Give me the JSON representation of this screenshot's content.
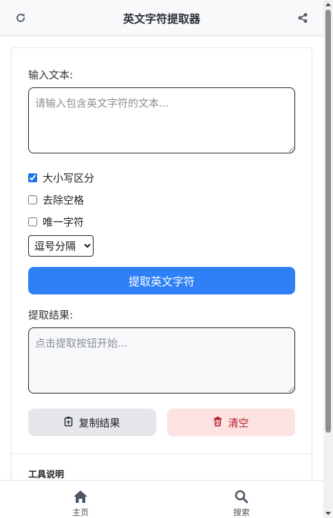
{
  "header": {
    "title": "英文字符提取器",
    "left_icon": "refresh-icon",
    "right_icon": "share-icon"
  },
  "form": {
    "input_label": "输入文本:",
    "input_placeholder": "请输入包含英文字符的文本...",
    "input_value": "",
    "options": [
      {
        "label": "大小写区分",
        "checked": true
      },
      {
        "label": "去除空格",
        "checked": false
      },
      {
        "label": "唯一字符",
        "checked": false
      }
    ],
    "separator_selected": "逗号分隔",
    "extract_button": "提取英文字符",
    "result_label": "提取结果:",
    "result_placeholder": "点击提取按钮开始...",
    "copy_button": "复制结果",
    "copy_icon": "clipboard-icon",
    "clear_button": "清空",
    "clear_icon": "trash-icon"
  },
  "info": {
    "title": "工具说明"
  },
  "bottom_nav": [
    {
      "label": "主页",
      "icon": "home-icon"
    },
    {
      "label": "搜索",
      "icon": "search-icon"
    }
  ],
  "colors": {
    "primary": "#2f80f7",
    "danger_text": "#b3202a",
    "danger_bg": "#fde2e2",
    "neutral_bg": "#e5e7eb"
  }
}
